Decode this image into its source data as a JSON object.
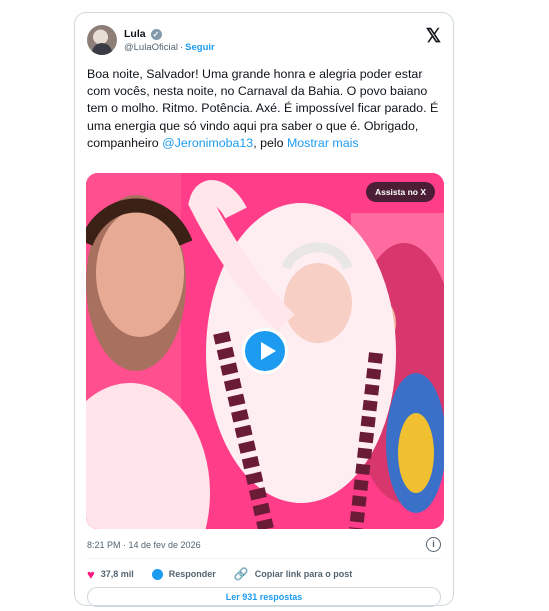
{
  "author": {
    "name": "Lula",
    "handle": "@LulaOficial",
    "follow_label": "Seguir"
  },
  "icons": {
    "verified": "verified-badge-icon",
    "x_logo": "x-logo-icon",
    "info": "info-icon",
    "heart": "heart-icon",
    "reply": "reply-icon",
    "link": "link-icon",
    "play": "play-icon"
  },
  "tweet": {
    "text_main": "Boa noite, Salvador! Uma grande honra e alegria poder estar com vocês, nesta noite, no Carnaval da Bahia. O povo baiano tem o molho. Ritmo. Potência. Axé. É impossível ficar parado. É uma energia que só vindo aqui pra saber o que é. Obrigado, companheiro ",
    "mention": "@Jeronimoba13",
    "text_tail": ", pelo ",
    "show_more": "Mostrar mais"
  },
  "media": {
    "watch_label": "Assista no X"
  },
  "meta": {
    "timestamp": "8:21 PM · 14 de fev de 2026"
  },
  "actions": {
    "likes": "37,8 mil",
    "reply": "Responder",
    "copy_link": "Copiar link para o post"
  },
  "replies_button": "Ler 931 respostas",
  "colors": {
    "accent": "#1d9bf0",
    "like": "#f91880",
    "video_bg": "#ff3a86"
  }
}
